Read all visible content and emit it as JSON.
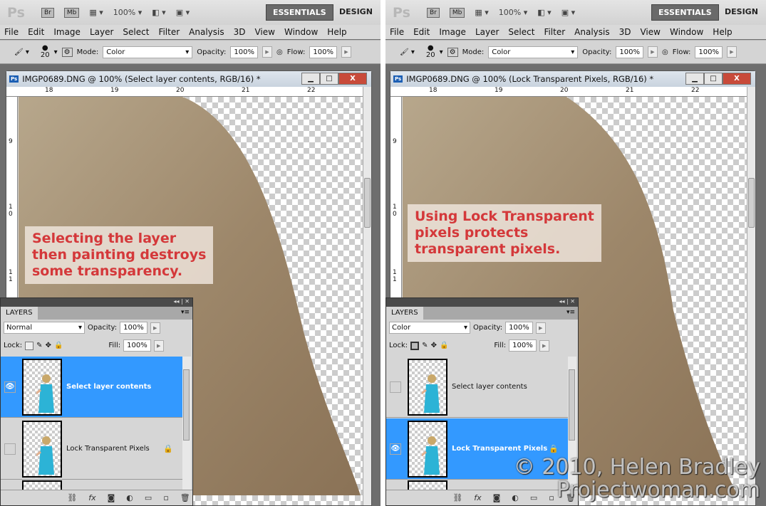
{
  "app": {
    "logo": "Ps",
    "bridge": "Br",
    "minibridge": "Mb",
    "zoom": "100%",
    "essentials": "ESSENTIALS",
    "design": "DESIGN"
  },
  "menu": [
    "File",
    "Edit",
    "Image",
    "Layer",
    "Select",
    "Filter",
    "Analysis",
    "3D",
    "View",
    "Window",
    "Help"
  ],
  "options": {
    "brush_size": "20",
    "mode_label": "Mode:",
    "mode_value": "Color",
    "opacity_label": "Opacity:",
    "opacity_value": "100%",
    "flow_label": "Flow:",
    "flow_value": "100%"
  },
  "left": {
    "doc_title": "IMGP0689.DNG @ 100% (Select layer contents, RGB/16) *",
    "ruler_h": [
      "18",
      "19",
      "20",
      "21",
      "22"
    ],
    "ruler_v": [
      "9",
      "1 0",
      "1 1"
    ],
    "caption": [
      "Selecting the layer",
      "then painting destroys",
      "some transparency."
    ],
    "layers": {
      "tab": "LAYERS",
      "blend": "Normal",
      "opacity_label": "Opacity:",
      "opacity": "100%",
      "lock_label": "Lock:",
      "fill_label": "Fill:",
      "fill": "100%",
      "items": [
        {
          "name": "Select layer contents",
          "selected": true,
          "visible": true
        },
        {
          "name": "Lock Transparent Pixels",
          "selected": false,
          "visible": false,
          "locked": true
        }
      ]
    }
  },
  "right": {
    "doc_title": "IMGP0689.DNG @ 100% (Lock Transparent Pixels, RGB/16) *",
    "ruler_h": [
      "18",
      "19",
      "20",
      "21",
      "22"
    ],
    "ruler_v": [
      "9",
      "1 0",
      "1 1"
    ],
    "caption": [
      "Using Lock Transparent",
      "pixels protects",
      "transparent pixels."
    ],
    "layers": {
      "tab": "LAYERS",
      "blend": "Color",
      "opacity_label": "Opacity:",
      "opacity": "100%",
      "lock_label": "Lock:",
      "fill_label": "Fill:",
      "fill": "100%",
      "items": [
        {
          "name": "Select layer contents",
          "selected": false,
          "visible": false
        },
        {
          "name": "Lock Transparent Pixels",
          "selected": true,
          "visible": true,
          "locked": true
        }
      ]
    }
  },
  "watermark": [
    "© 2010, Helen Bradley",
    "Projectwoman.com"
  ],
  "colors": {
    "selection": "#3399ff",
    "caption_text": "#d4383a",
    "hair": "#a28e72"
  }
}
